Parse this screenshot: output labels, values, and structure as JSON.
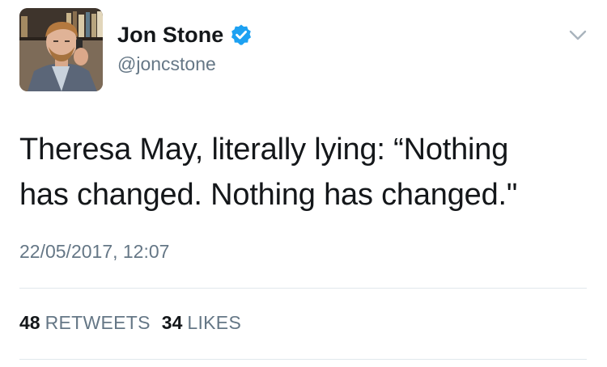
{
  "author": {
    "display_name": "Jon Stone",
    "handle": "@joncstone",
    "verified": true
  },
  "tweet": {
    "text_lines": [
      "Theresa May, literally lying: “Nothing",
      "has changed. Nothing has changed.\""
    ],
    "timestamp": "22/05/2017, 12:07"
  },
  "stats": {
    "retweets_count": "48",
    "retweets_label": "RETWEETS",
    "likes_count": "34",
    "likes_label": "LIKES"
  },
  "icons": {
    "verified": "verified-badge-icon",
    "menu": "chevron-down-icon"
  },
  "colors": {
    "text_primary": "#14171a",
    "text_secondary": "#657786",
    "verified_blue": "#1da1f2",
    "divider": "#e1e8ed"
  }
}
